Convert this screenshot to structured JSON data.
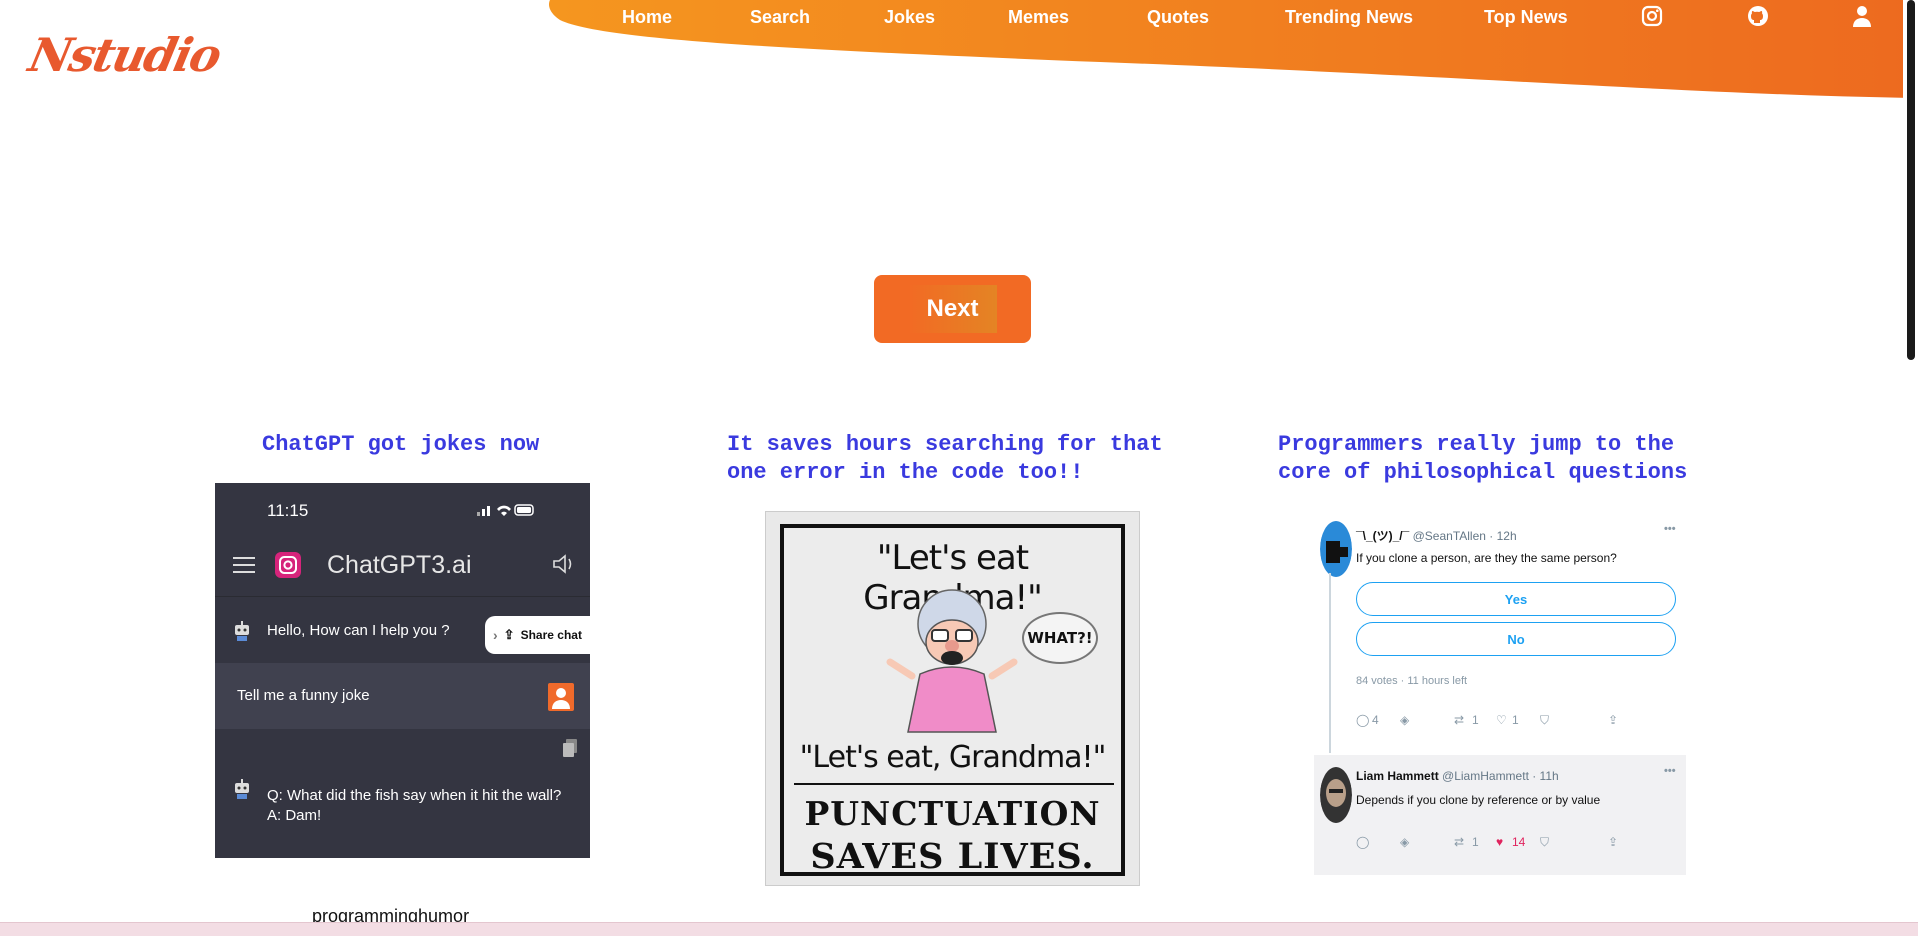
{
  "brand": {
    "logo_text": "Nstudio",
    "accent": "#f26a24",
    "title_color": "#3a3adf"
  },
  "nav": {
    "items": [
      {
        "label": "Home"
      },
      {
        "label": "Search"
      },
      {
        "label": "Jokes"
      },
      {
        "label": "Memes"
      },
      {
        "label": "Quotes"
      },
      {
        "label": "Trending News"
      },
      {
        "label": "Top News"
      }
    ],
    "icons": [
      "instagram-icon",
      "github-icon",
      "user-icon"
    ]
  },
  "next_button": {
    "label": "Next"
  },
  "cards": [
    {
      "title": "ChatGPT got jokes now",
      "chat": {
        "time": "11:15",
        "app_title": "ChatGPT3.ai",
        "greeting": "Hello, How can I help you ?",
        "share_label": "Share chat",
        "user_message": "Tell me a funny joke",
        "answer_q": "Q: What did the fish say when it hit the wall?",
        "answer_a": "A: Dam!"
      },
      "caption": "programminghumor"
    },
    {
      "title": "It saves hours searching for that one error in the code too!!",
      "poster": {
        "quote1": "\"Let's eat Grandma!\"",
        "bubble": "WHAT?!",
        "quote2": "\"Let's eat, Grandma!\"",
        "line1": "PUNCTUATION",
        "line2": "SAVES LIVES."
      }
    },
    {
      "title": "Programmers really jump to the core of philosophical questions",
      "tweet": {
        "user1_name": "¯\\_(ツ)_/¯",
        "user1_meta": "@SeanTAllen · 12h",
        "question": "If you clone a person, are they the same person?",
        "poll_options": [
          "Yes",
          "No"
        ],
        "poll_meta": "84 votes · 11 hours left",
        "actions1": {
          "replies": "4",
          "retweets": "1",
          "likes": "1"
        },
        "user2_name": "Liam Hammett",
        "user2_meta": "@LiamHammett · 11h",
        "reply": "Depends if you clone by reference or by value",
        "actions2": {
          "retweets": "1",
          "likes": "14"
        }
      }
    }
  ]
}
